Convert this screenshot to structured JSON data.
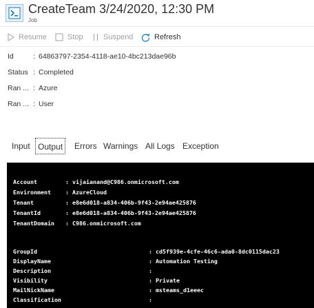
{
  "header": {
    "title": "CreateTeam 3/24/2020, 12:30 PM",
    "subtitle": "Job"
  },
  "toolbar": {
    "resume": "Resume",
    "stop": "Stop",
    "suspend": "Suspend",
    "refresh": "Refresh"
  },
  "properties": [
    {
      "label": "Id",
      "value": "64863797-2354-4118-ae10-4bc213dae96b"
    },
    {
      "label": "Status",
      "value": "Completed"
    },
    {
      "label": "Ran ...",
      "value": "Azure"
    },
    {
      "label": "Ran ...",
      "value": "User"
    }
  ],
  "tabs": [
    "Input",
    "Output",
    "Errors",
    "Warnings",
    "All Logs",
    "Exception"
  ],
  "active_tab": "Output",
  "console": {
    "block1": [
      {
        "key": "Account",
        "value": "vijaianand@C986.onmicrosoft.com"
      },
      {
        "key": "Environment",
        "value": "AzureCloud"
      },
      {
        "key": "Tenant",
        "value": "e8e6d018-a834-406b-9f43-2e94ae425876"
      },
      {
        "key": "TenantId",
        "value": "e8e6d018-a834-406b-9f43-2e94ae425876"
      },
      {
        "key": "TenantDomain",
        "value": "C986.onmicrosoft.com"
      }
    ],
    "block2": [
      {
        "key": "GroupId",
        "value": "cd5f939e-4cfe-46c6-ada0-8dc0115dac23"
      },
      {
        "key": "DisplayName",
        "value": "Automation Testing"
      },
      {
        "key": "Description",
        "value": ""
      },
      {
        "key": "Visibility",
        "value": "Private"
      },
      {
        "key": "MailNickName",
        "value": "msteams_d1eeec"
      },
      {
        "key": "Classification",
        "value": ""
      }
    ]
  }
}
